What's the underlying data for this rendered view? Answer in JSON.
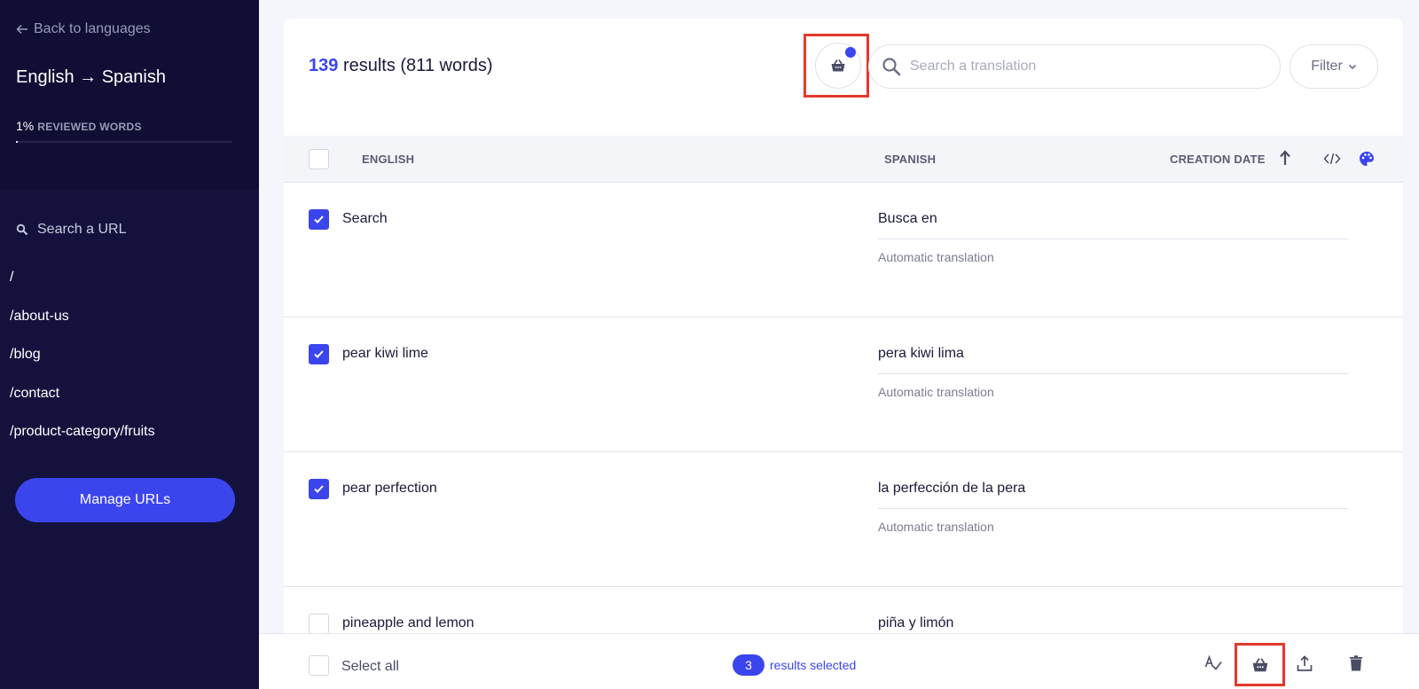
{
  "sidebar": {
    "back_label": "Back to languages",
    "title": "English → Spanish",
    "reviewed_percent": "1%",
    "reviewed_label": "REVIEWED WORDS",
    "reviewed_progress": 0.01,
    "url_search_placeholder": "Search a URL",
    "urls": [
      "/",
      "/about-us",
      "/blog",
      "/contact",
      "/product-category/fruits"
    ],
    "manage_label": "Manage URLs"
  },
  "header": {
    "results_count": "139",
    "results_text": "results (811 words)",
    "search_placeholder": "Search a translation",
    "filter_label": "Filter"
  },
  "table": {
    "col_source": "ENGLISH",
    "col_target": "SPANISH",
    "col_date": "CREATION DATE",
    "rows": [
      {
        "en": "Search",
        "es": "Busca en",
        "status": "Automatic translation",
        "checked": true
      },
      {
        "en": "pear kiwi lime",
        "es": "pera kiwi lima",
        "status": "Automatic translation",
        "checked": true
      },
      {
        "en": "pear perfection",
        "es": "la perfección de la pera",
        "status": "Automatic translation",
        "checked": true
      },
      {
        "en": "pineapple and lemon",
        "es": "piña y limón",
        "status": "",
        "checked": false
      }
    ]
  },
  "bottom_bar": {
    "select_all_label": "Select all",
    "selected_count": "3",
    "selected_text": "results selected"
  },
  "colors": {
    "accent": "#3b45ee",
    "sidebar_bg": "#14123d",
    "highlight": "#e23a2a"
  },
  "icons": [
    "arrow-left-icon",
    "search-icon",
    "basket-icon",
    "chevron-down-icon",
    "sort-up-icon",
    "code-icon",
    "palette-icon",
    "spellcheck-icon",
    "upload-icon",
    "trash-icon",
    "check-icon"
  ]
}
